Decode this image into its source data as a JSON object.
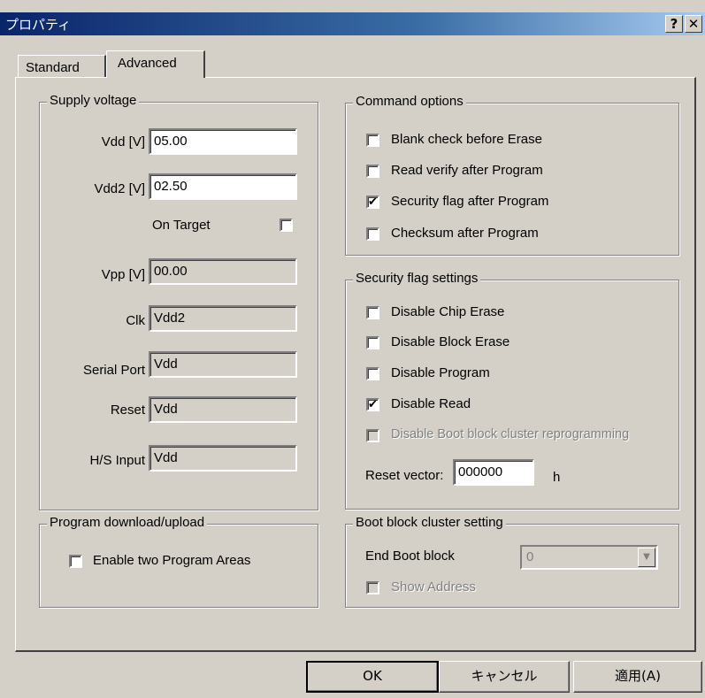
{
  "window": {
    "title": "プロパティ",
    "help_label": "?",
    "close_label": "✕"
  },
  "tabs": [
    {
      "label": "Standard"
    },
    {
      "label": "Advanced"
    }
  ],
  "supply_voltage": {
    "legend": "Supply voltage",
    "vdd_label": "Vdd [V]",
    "vdd_value": "05.00",
    "vdd2_label": "Vdd2 [V]",
    "vdd2_value": "02.50",
    "on_target_label": "On Target",
    "on_target_checked": false,
    "vpp_label": "Vpp [V]",
    "vpp_value": "00.00",
    "clk_label": "Clk",
    "clk_value": "Vdd2",
    "serial_label": "Serial Port",
    "serial_value": "Vdd",
    "reset_label": "Reset",
    "reset_value": "Vdd",
    "hs_label": "H/S Input",
    "hs_value": "Vdd"
  },
  "command_options": {
    "legend": "Command options",
    "items": [
      {
        "label": "Blank check before Erase",
        "mark": ""
      },
      {
        "label": "Read verify after Program",
        "mark": ""
      },
      {
        "label": "Security flag after Program",
        "mark": "✔"
      },
      {
        "label": "Checksum after Program",
        "mark": ""
      }
    ]
  },
  "security_flags": {
    "legend": "Security flag settings",
    "items": [
      {
        "label": "Disable Chip Erase",
        "mark": ""
      },
      {
        "label": "Disable Block Erase",
        "mark": ""
      },
      {
        "label": "Disable Program",
        "mark": ""
      },
      {
        "label": "Disable Read",
        "mark": "✔"
      },
      {
        "label": "Disable Boot block cluster reprogramming",
        "mark": ""
      }
    ],
    "reset_vector_label": "Reset vector:",
    "reset_vector_value": "000000",
    "reset_vector_unit": "h"
  },
  "program_download": {
    "legend": "Program download/upload",
    "enable_two_label": "Enable two Program Areas",
    "enable_two_mark": ""
  },
  "boot_block": {
    "legend": "Boot block cluster setting",
    "end_boot_label": "End Boot block",
    "end_boot_value": "0",
    "dropdown_arrow": "▼",
    "show_address_label": "Show Address",
    "show_address_mark": ""
  },
  "buttons": {
    "ok": "OK",
    "cancel": "キャンセル",
    "apply": "適用(A)"
  },
  "colors": {
    "face": "#d4d0c8",
    "titlebar_start": "#0a246a",
    "titlebar_end": "#a6caf0",
    "disabled_text": "#808080"
  }
}
